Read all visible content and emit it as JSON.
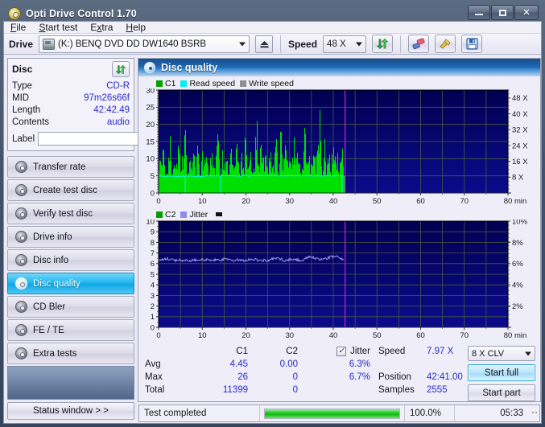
{
  "window": {
    "title": "Opti Drive Control 1.70",
    "icon": "disc-icon",
    "minimize": "minimize",
    "maximize": "maximize",
    "close": "close"
  },
  "menu": {
    "items": [
      {
        "label": "File"
      },
      {
        "label": "Start test"
      },
      {
        "label": "Extra"
      },
      {
        "label": "Help"
      }
    ]
  },
  "toolbar": {
    "drive_label": "Drive",
    "drive_value": "(K:)  BENQ DVD DD DW1640 BSRB",
    "eject_icon": "eject-icon",
    "speed_label": "Speed",
    "speed_value": "48 X",
    "refresh_icon": "refresh-icon",
    "eraser_icon": "eraser-icon",
    "tools_icon": "tools-icon",
    "save_icon": "save-icon"
  },
  "disc": {
    "header": "Disc",
    "refresh_icon": "refresh-icon",
    "fields": [
      {
        "key": "Type",
        "value": "CD-R"
      },
      {
        "key": "MID",
        "value": "97m26s66f"
      },
      {
        "key": "Length",
        "value": "42:42.49"
      },
      {
        "key": "Contents",
        "value": "audio"
      }
    ],
    "label_key": "Label",
    "label_value": "",
    "label_placeholder": "",
    "label_button_icon": "cd-icon"
  },
  "nav": {
    "items": [
      {
        "label": "Transfer rate",
        "icon": "disc-icon",
        "active": false
      },
      {
        "label": "Create test disc",
        "icon": "disc-icon",
        "active": false
      },
      {
        "label": "Verify test disc",
        "icon": "disc-icon",
        "active": false
      },
      {
        "label": "Drive info",
        "icon": "disc-icon",
        "active": false
      },
      {
        "label": "Disc info",
        "icon": "disc-icon",
        "active": false
      },
      {
        "label": "Disc quality",
        "icon": "disc-icon",
        "active": true
      },
      {
        "label": "CD Bler",
        "icon": "disc-icon",
        "active": false
      },
      {
        "label": "FE / TE",
        "icon": "disc-icon",
        "active": false
      },
      {
        "label": "Extra tests",
        "icon": "disc-icon",
        "active": false
      }
    ],
    "status_window": "Status window > >"
  },
  "panel": {
    "title": "Disc quality",
    "icon": "disc-icon"
  },
  "chart_data": [
    {
      "type": "bar",
      "name": "c1-chart",
      "title": "",
      "xlabel": "min",
      "ylabel": "",
      "xlim": [
        0,
        80
      ],
      "ylim": [
        0,
        30
      ],
      "yticks": [
        0,
        5,
        10,
        15,
        20,
        25,
        30
      ],
      "xticks": [
        0,
        10,
        20,
        30,
        40,
        50,
        60,
        70,
        80
      ],
      "y2label": "",
      "y2lim": [
        0,
        52
      ],
      "y2ticks": [
        "8 X",
        "16 X",
        "24 X",
        "32 X",
        "40 X",
        "48 X"
      ],
      "y2tick_values": [
        8,
        16,
        24,
        32,
        40,
        48
      ],
      "grid": true,
      "legend_position": "top-left",
      "legend": [
        {
          "name": "C1",
          "color": "#00a000"
        },
        {
          "name": "Read speed",
          "color": "#00f0f0"
        },
        {
          "name": "Write speed",
          "color": "#909090"
        }
      ],
      "background": "#000060",
      "data_end_x": 42.7,
      "marker_x": 42.7,
      "series": [
        {
          "name": "C1",
          "type": "bar",
          "color": "#00e000",
          "baseline": 5,
          "x": [
            0,
            0.5,
            1,
            1.5,
            2,
            2.5,
            3,
            3.5,
            4,
            4.5,
            5,
            5.5,
            6,
            6.5,
            7,
            7.5,
            8,
            8.5,
            9,
            9.5,
            10,
            10.5,
            11,
            11.5,
            12,
            12.5,
            13,
            13.5,
            14,
            14.5,
            15,
            15.5,
            16,
            16.5,
            17,
            17.5,
            18,
            18.5,
            19,
            19.5,
            20,
            20.5,
            21,
            21.5,
            22,
            22.5,
            23,
            23.5,
            24,
            24.5,
            25,
            25.5,
            26,
            26.5,
            27,
            27.5,
            28,
            28.5,
            29,
            29.5,
            30,
            30.5,
            31,
            31.5,
            32,
            32.5,
            33,
            33.5,
            34,
            34.5,
            35,
            35.5,
            36,
            36.5,
            37,
            37.5,
            38,
            38.5,
            39,
            39.5,
            40,
            40.5,
            41,
            41.5,
            42,
            42.5
          ],
          "values": [
            11,
            7,
            13,
            5,
            9,
            16,
            6,
            12,
            8,
            14,
            7,
            10,
            18,
            6,
            11,
            9,
            13,
            7,
            16,
            5,
            12,
            8,
            15,
            6,
            10,
            13,
            7,
            17,
            5,
            11,
            8,
            14,
            6,
            12,
            9,
            7,
            15,
            5,
            10,
            8,
            19,
            6,
            13,
            7,
            11,
            21,
            5,
            16,
            9,
            12,
            6,
            14,
            8,
            10,
            17,
            5,
            26,
            7,
            13,
            9,
            11,
            6,
            15,
            8,
            12,
            5,
            10,
            18,
            7,
            13,
            6,
            16,
            9,
            11,
            22,
            5,
            14,
            8,
            12,
            6,
            15,
            9,
            11,
            7,
            13,
            5
          ]
        },
        {
          "name": "Read speed",
          "type": "line",
          "color": "#00f6f6",
          "x": [
            0,
            5,
            10,
            15,
            20,
            25,
            30,
            35,
            40,
            42.7
          ],
          "values": [
            4.9,
            4.9,
            4.9,
            5.0,
            5.0,
            5.0,
            5.0,
            5.0,
            5.0,
            5.0
          ]
        }
      ]
    },
    {
      "type": "line",
      "name": "c2-jitter-chart",
      "title": "",
      "xlabel": "min",
      "ylabel": "",
      "xlim": [
        0,
        80
      ],
      "ylim": [
        0,
        10
      ],
      "yticks": [
        0,
        1,
        2,
        3,
        4,
        5,
        6,
        7,
        8,
        9,
        10
      ],
      "xticks": [
        0,
        10,
        20,
        30,
        40,
        50,
        60,
        70,
        80
      ],
      "y2lim": [
        0,
        10
      ],
      "y2ticks": [
        "2%",
        "4%",
        "6%",
        "8%",
        "10%"
      ],
      "y2tick_values": [
        2,
        4,
        6,
        8,
        10
      ],
      "grid": true,
      "legend_position": "top-left",
      "legend": [
        {
          "name": "C2",
          "color": "#00a000"
        },
        {
          "name": "Jitter",
          "color": "#8f8fe8"
        }
      ],
      "background": "#000060",
      "data_end_x": 42.7,
      "marker_x": 42.7,
      "series": [
        {
          "name": "C2",
          "type": "bar",
          "color": "#00e000",
          "x": [],
          "values": []
        },
        {
          "name": "Jitter",
          "type": "line",
          "color": "#9a9aee",
          "x": [
            0,
            2,
            4,
            6,
            8,
            10,
            12,
            14,
            16,
            18,
            20,
            22,
            24,
            26,
            28,
            30,
            32,
            34,
            36,
            38,
            40,
            42,
            42.7
          ],
          "values": [
            6.3,
            6.4,
            6.3,
            6.3,
            6.3,
            6.4,
            6.3,
            6.3,
            6.4,
            6.3,
            6.3,
            6.4,
            6.3,
            6.3,
            6.5,
            6.3,
            6.4,
            6.3,
            6.6,
            6.4,
            6.5,
            6.7,
            6.3
          ]
        }
      ]
    }
  ],
  "stats": {
    "columns": [
      "",
      "C1",
      "C2",
      "Jitter"
    ],
    "jitter_checked": true,
    "jitter_check_glyph": "✓",
    "rows": [
      {
        "label": "Avg",
        "c1": "4.45",
        "c2": "0.00",
        "jitter": "6.3%"
      },
      {
        "label": "Max",
        "c1": "26",
        "c2": "0",
        "jitter": "6.7%"
      },
      {
        "label": "Total",
        "c1": "11399",
        "c2": "0",
        "jitter": ""
      }
    ]
  },
  "readout": {
    "speed_label": "Speed",
    "speed_value": "7.97 X",
    "position_label": "Position",
    "position_value": "42:41.00",
    "samples_label": "Samples",
    "samples_value": "2555",
    "mode_value": "8 X CLV",
    "start_full": "Start full",
    "start_part": "Start part"
  },
  "statusbar": {
    "message": "Test completed",
    "progress_percent": 100.0,
    "progress_text": "100.0%",
    "elapsed": "05:33"
  }
}
